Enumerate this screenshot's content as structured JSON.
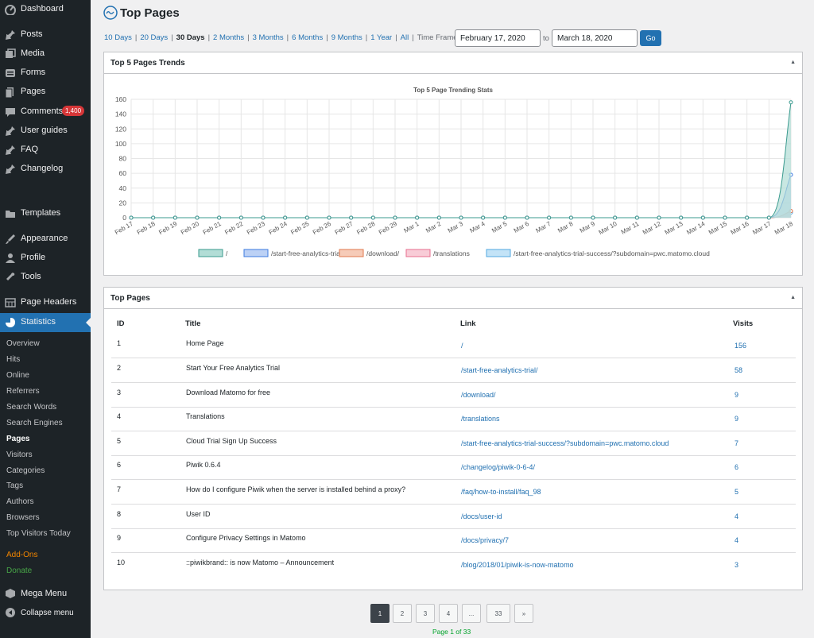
{
  "sidebar": {
    "items": [
      {
        "label": "Dashboard",
        "icon": "dashboard-icon"
      },
      {
        "label": "Posts",
        "icon": "pin-icon"
      },
      {
        "label": "Media",
        "icon": "media-icon"
      },
      {
        "label": "Forms",
        "icon": "forms-icon"
      },
      {
        "label": "Pages",
        "icon": "pages-icon"
      },
      {
        "label": "Comments",
        "icon": "comments-icon",
        "badge": "1,400"
      },
      {
        "label": "User guides",
        "icon": "pin-icon"
      },
      {
        "label": "FAQ",
        "icon": "pin-icon"
      },
      {
        "label": "Changelog",
        "icon": "pin-icon"
      },
      {
        "label": "Templates",
        "icon": "folder-icon"
      },
      {
        "label": "Appearance",
        "icon": "brush-icon"
      },
      {
        "label": "Profile",
        "icon": "user-icon"
      },
      {
        "label": "Tools",
        "icon": "wrench-icon"
      },
      {
        "label": "Page Headers",
        "icon": "grid-icon"
      },
      {
        "label": "Statistics",
        "icon": "pie-icon"
      }
    ],
    "submenu": [
      "Overview",
      "Hits",
      "Online",
      "Referrers",
      "Search Words",
      "Search Engines",
      "Pages",
      "Visitors",
      "Categories",
      "Tags",
      "Authors",
      "Browsers",
      "Top Visitors Today",
      "Add-Ons",
      "Donate"
    ],
    "bottom": [
      {
        "label": "Mega Menu",
        "icon": "mega-menu-icon"
      },
      {
        "label": "Collapse menu",
        "icon": "collapse-icon"
      }
    ]
  },
  "header": {
    "title": "Top Pages"
  },
  "range": {
    "links": [
      "10 Days",
      "20 Days",
      "30 Days",
      "2 Months",
      "3 Months",
      "6 Months",
      "9 Months",
      "1 Year",
      "All"
    ],
    "current": "30 Days",
    "timeframe_label": "Time Frame:",
    "from": "February 17, 2020",
    "to_label": "to",
    "to": "March 18, 2020",
    "go": "Go"
  },
  "trends_panel": {
    "title": "Top 5 Pages Trends"
  },
  "chart_data": {
    "type": "area",
    "title": "Top 5 Page Trending Stats",
    "categories": [
      "Feb 17",
      "Feb 18",
      "Feb 19",
      "Feb 20",
      "Feb 21",
      "Feb 22",
      "Feb 23",
      "Feb 24",
      "Feb 25",
      "Feb 26",
      "Feb 27",
      "Feb 28",
      "Feb 29",
      "Mar 1",
      "Mar 2",
      "Mar 3",
      "Mar 4",
      "Mar 5",
      "Mar 6",
      "Mar 7",
      "Mar 8",
      "Mar 9",
      "Mar 10",
      "Mar 11",
      "Mar 12",
      "Mar 13",
      "Mar 14",
      "Mar 15",
      "Mar 16",
      "Mar 17",
      "Mar 18"
    ],
    "ylim": [
      0,
      160
    ],
    "yticks": [
      0,
      20,
      40,
      60,
      80,
      100,
      120,
      140,
      160
    ],
    "grid": true,
    "legend": "bottom",
    "series": [
      {
        "name": "/",
        "color": "#3b9b8f",
        "fill": "#b2ddd6",
        "last": 156
      },
      {
        "name": "/start-free-analytics-trial/",
        "color": "#3d7be0",
        "fill": "#bcd1f5",
        "last": 58
      },
      {
        "name": "/download/",
        "color": "#e07a4f",
        "fill": "#f6cbb8",
        "last": 9
      },
      {
        "name": "/translations",
        "color": "#e76f8f",
        "fill": "#f8ccd7",
        "last": 9
      },
      {
        "name": "/start-free-analytics-trial-success/?subdomain=pwc.matomo.cloud",
        "color": "#53a9e0",
        "fill": "#c3e3f7",
        "last": 7
      }
    ]
  },
  "pages_panel": {
    "title": "Top Pages",
    "headers": [
      "ID",
      "Title",
      "Link",
      "Visits"
    ],
    "rows": [
      {
        "id": "1",
        "title": "Home Page",
        "link": "/",
        "visits": "156"
      },
      {
        "id": "2",
        "title": "Start Your Free Analytics Trial",
        "link": "/start-free-analytics-trial/",
        "visits": "58"
      },
      {
        "id": "3",
        "title": "Download Matomo for free",
        "link": "/download/",
        "visits": "9"
      },
      {
        "id": "4",
        "title": "Translations",
        "link": "/translations",
        "visits": "9"
      },
      {
        "id": "5",
        "title": "Cloud Trial Sign Up Success",
        "link": "/start-free-analytics-trial-success/?subdomain=pwc.matomo.cloud",
        "visits": "7"
      },
      {
        "id": "6",
        "title": "Piwik 0.6.4",
        "link": "/changelog/piwik-0-6-4/",
        "visits": "6"
      },
      {
        "id": "7",
        "title": "How do I configure Piwik when the server is installed behind a proxy?",
        "link": "/faq/how-to-install/faq_98",
        "visits": "5"
      },
      {
        "id": "8",
        "title": "User ID",
        "link": "/docs/user-id",
        "visits": "4"
      },
      {
        "id": "9",
        "title": "Configure Privacy Settings in Matomo",
        "link": "/docs/privacy/7",
        "visits": "4"
      },
      {
        "id": "10",
        "title": "::piwikbrand:: is now Matomo – Announcement",
        "link": "/blog/2018/01/piwik-is-now-matomo",
        "visits": "3"
      }
    ]
  },
  "pagination": {
    "pages": [
      "1",
      "2",
      "3",
      "4",
      "...",
      "33",
      "»"
    ],
    "current": "1",
    "status": "Page 1 of 33"
  }
}
